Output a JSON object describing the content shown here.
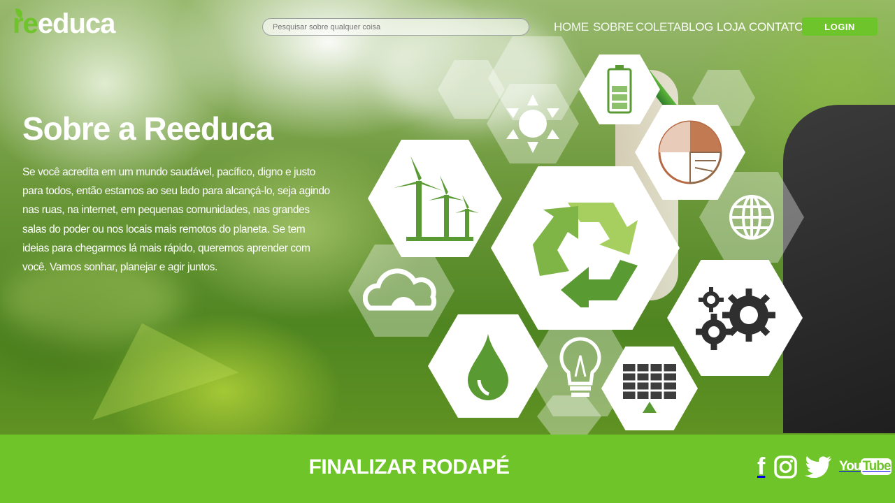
{
  "brand": {
    "logo_prefix": "re",
    "logo_suffix": "educa",
    "accent_color": "#6fc42a"
  },
  "header": {
    "search_placeholder": "Pesquisar sobre qualquer coisa",
    "nav": [
      {
        "label": "HOME"
      },
      {
        "label": "SOBRE"
      },
      {
        "label": "COLETA"
      },
      {
        "label": "BLOG"
      },
      {
        "label": "LOJA"
      },
      {
        "label": "CONTATO"
      }
    ],
    "login_label": "LOGIN"
  },
  "main": {
    "title": "Sobre a Reeduca",
    "paragraph": "Se você acredita em um mundo saudável, pacífico, digno e justo para todos, então estamos ao seu lado para alcançá-lo, seja agindo nas ruas, na internet, em pequenas comunidades, nas grandes salas do poder ou nos locais mais remotos do planeta. Se tem ideias para chegarmos lá mais rápido, queremos aprender com você. Vamos sonhar, planejar e agir juntos."
  },
  "hero_icons": [
    "sun-icon",
    "battery-icon",
    "pie-chart-icon",
    "wind-turbines-icon",
    "recycle-icon",
    "globe-icon",
    "cloud-sun-icon",
    "gears-icon",
    "water-drop-icon",
    "light-bulb-icon",
    "solar-panel-icon"
  ],
  "footer": {
    "text": "FINALIZAR RODAPÉ",
    "social": [
      {
        "name": "facebook-icon",
        "label": "f"
      },
      {
        "name": "instagram-icon"
      },
      {
        "name": "twitter-icon"
      },
      {
        "name": "youtube-icon",
        "label_a": "You",
        "label_b": "Tube"
      }
    ]
  }
}
